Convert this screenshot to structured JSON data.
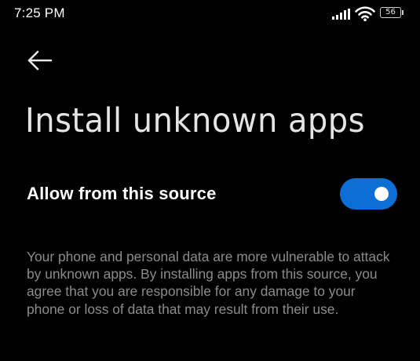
{
  "status_bar": {
    "time": "7:25 PM",
    "battery_level": "56",
    "icons": [
      "signal-icon",
      "wifi-icon",
      "battery-icon"
    ]
  },
  "header": {
    "back_icon": "back-arrow-icon",
    "title": "Install unknown apps"
  },
  "setting": {
    "label": "Allow from this source",
    "enabled": true
  },
  "description": "Your phone and personal data are more vulnerable to attack by unknown apps. By installing apps from this source, you agree that you are responsible for any damage to your phone or loss of data that may result from their use.",
  "colors": {
    "background": "#000000",
    "accent": "#0d6fd6",
    "secondary_text": "#8c8c8c"
  }
}
